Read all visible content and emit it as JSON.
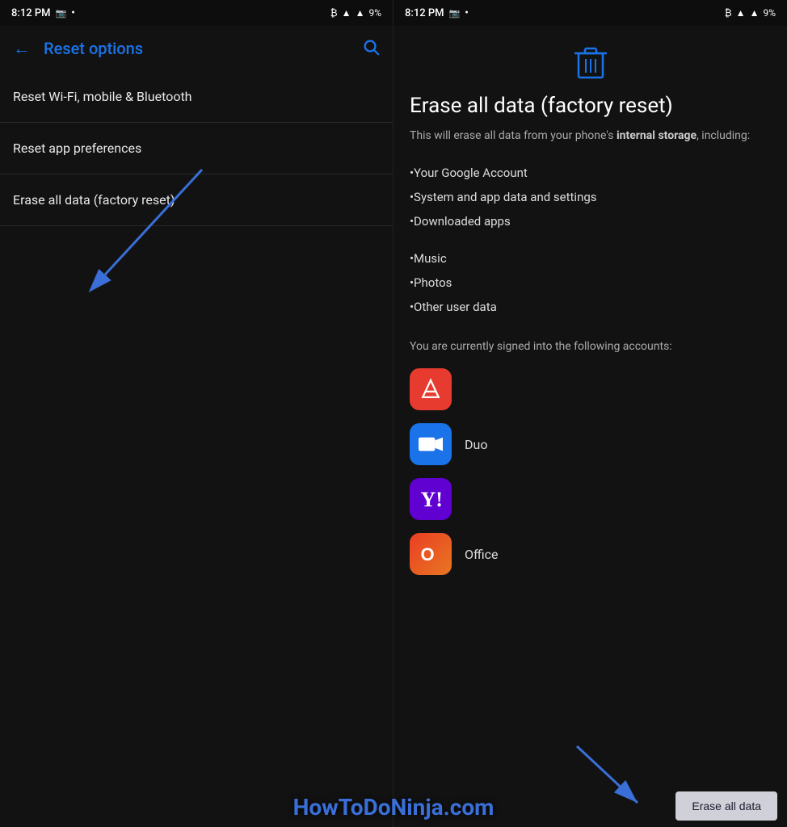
{
  "left": {
    "statusBar": {
      "time": "8:12 PM",
      "battery": "9%"
    },
    "toolbar": {
      "backLabel": "←",
      "title": "Reset options",
      "searchLabel": "🔍"
    },
    "menuItems": [
      {
        "id": "wifi",
        "label": "Reset Wi-Fi, mobile & Bluetooth"
      },
      {
        "id": "app-prefs",
        "label": "Reset app preferences"
      },
      {
        "id": "factory",
        "label": "Erase all data (factory reset)"
      }
    ]
  },
  "right": {
    "statusBar": {
      "time": "8:12 PM",
      "battery": "9%"
    },
    "title": "Erase all data (factory reset)",
    "subtitle_plain": "This will erase all data from your phone's ",
    "subtitle_bold": "internal storage",
    "subtitle_end": ", including:",
    "dataItems": [
      "•Your Google Account",
      "•System and app data and settings",
      "•Downloaded apps",
      "•Music",
      "•Photos",
      "•Other user data"
    ],
    "accountsText": "You are currently signed into the following accounts:",
    "accounts": [
      {
        "id": "adobe",
        "name": "",
        "iconType": "adobe"
      },
      {
        "id": "duo",
        "name": "Duo",
        "iconType": "duo"
      },
      {
        "id": "yahoo",
        "name": "",
        "iconType": "yahoo"
      },
      {
        "id": "office",
        "name": "Office",
        "iconType": "office"
      }
    ],
    "eraseButton": "Erase all data"
  },
  "watermark": "HowToDoNinja.com"
}
